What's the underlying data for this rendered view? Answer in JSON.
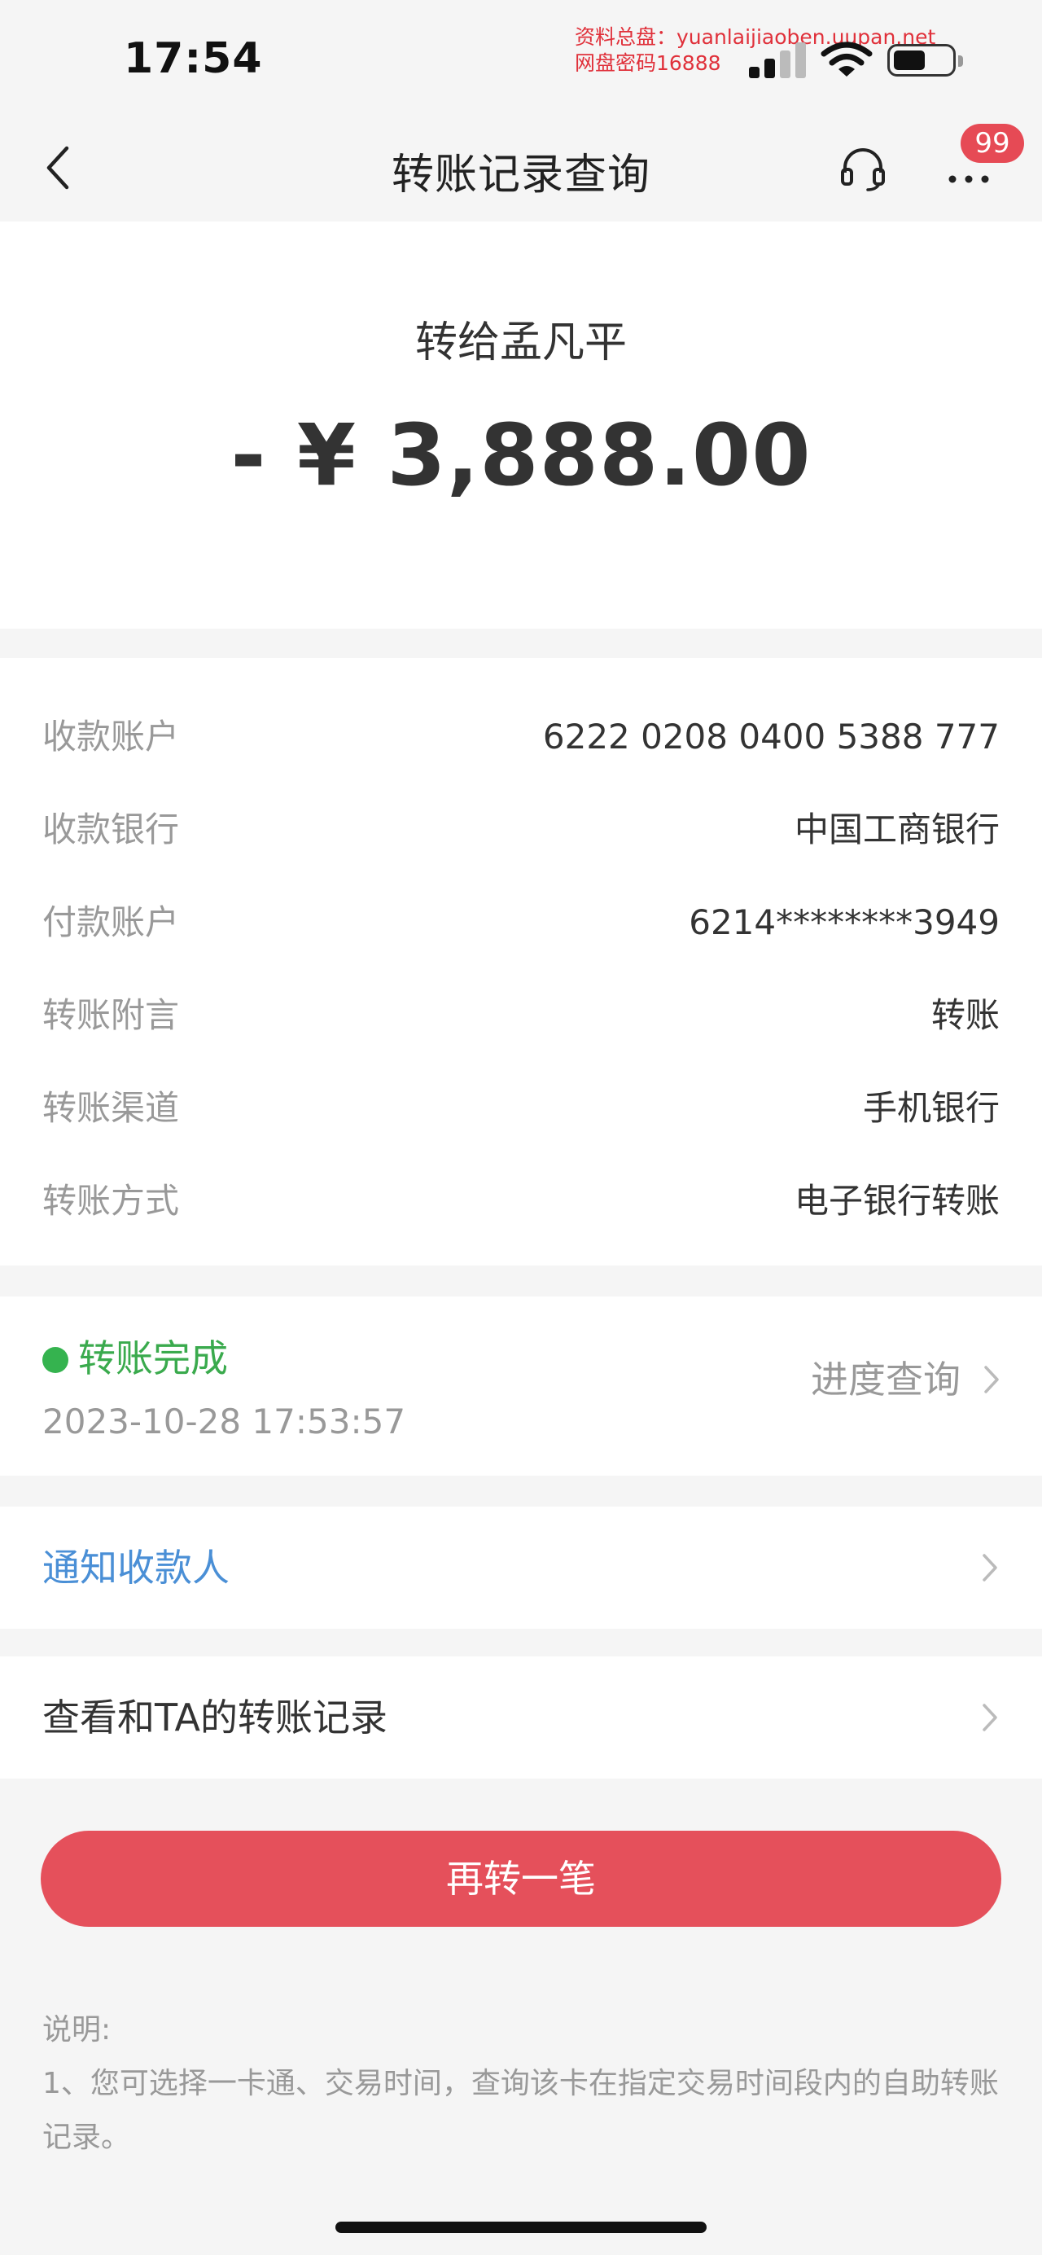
{
  "status_bar": {
    "time": "17:54",
    "watermark_line1": "资料总盘：yuanlaijiaoben.uupan.net",
    "watermark_line2": "网盘密码16888"
  },
  "nav": {
    "title": "转账记录查询",
    "badge_count": "99"
  },
  "transfer": {
    "payee_line": "转给孟凡平",
    "amount": "- ¥ 3,888.00"
  },
  "details": [
    {
      "label": "收款账户",
      "value": "6222 0208 0400 5388 777"
    },
    {
      "label": "收款银行",
      "value": "中国工商银行"
    },
    {
      "label": "付款账户",
      "value": "6214********3949"
    },
    {
      "label": "转账附言",
      "value": "转账"
    },
    {
      "label": "转账渠道",
      "value": "手机银行"
    },
    {
      "label": "转账方式",
      "value": "电子银行转账"
    }
  ],
  "status": {
    "text": "转账完成",
    "time": "2023-10-28 17:53:57",
    "progress_link": "进度查询",
    "dot_color": "#35b34f"
  },
  "actions": {
    "notify_payee": "通知收款人",
    "view_records": "查看和TA的转账记录",
    "transfer_again": "再转一笔"
  },
  "notes": {
    "title": "说明:",
    "line1": "1、您可选择一卡通、交易时间，查询该卡在指定交易时间段内的自助转账记录。"
  },
  "colors": {
    "accent_red": "#e5505b",
    "link_blue": "#4a8fd6",
    "success_green": "#3aaa4d"
  }
}
